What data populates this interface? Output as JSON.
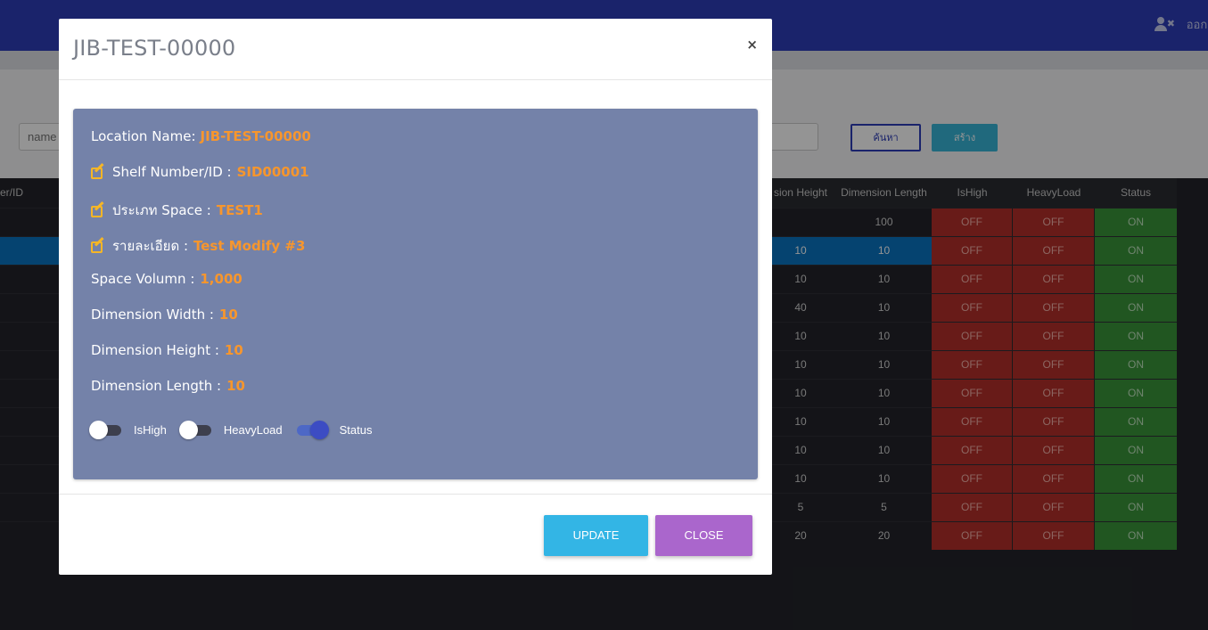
{
  "topbar": {
    "logout_label": "ออกจาก"
  },
  "search": {
    "placeholder": "name",
    "search_label": "ค้นหา",
    "create_label": "สร้าง"
  },
  "table": {
    "left_header_fragment": "er/ID",
    "headers": [
      "sion Height",
      "Dimension Length",
      "IsHigh",
      "HeavyLoad",
      "Status"
    ],
    "rows": [
      {
        "height": "",
        "length": "100",
        "ishigh": "OFF",
        "heavyload": "OFF",
        "status": "ON"
      },
      {
        "height": "10",
        "length": "10",
        "ishigh": "OFF",
        "heavyload": "OFF",
        "status": "ON",
        "selected": true
      },
      {
        "height": "10",
        "length": "10",
        "ishigh": "OFF",
        "heavyload": "OFF",
        "status": "ON"
      },
      {
        "height": "40",
        "length": "10",
        "ishigh": "OFF",
        "heavyload": "OFF",
        "status": "ON"
      },
      {
        "height": "10",
        "length": "10",
        "ishigh": "OFF",
        "heavyload": "OFF",
        "status": "ON"
      },
      {
        "height": "10",
        "length": "10",
        "ishigh": "OFF",
        "heavyload": "OFF",
        "status": "ON"
      },
      {
        "height": "10",
        "length": "10",
        "ishigh": "OFF",
        "heavyload": "OFF",
        "status": "ON"
      },
      {
        "height": "10",
        "length": "10",
        "ishigh": "OFF",
        "heavyload": "OFF",
        "status": "ON"
      },
      {
        "height": "10",
        "length": "10",
        "ishigh": "OFF",
        "heavyload": "OFF",
        "status": "ON"
      },
      {
        "height": "10",
        "length": "10",
        "ishigh": "OFF",
        "heavyload": "OFF",
        "status": "ON"
      },
      {
        "height": "5",
        "length": "5",
        "ishigh": "OFF",
        "heavyload": "OFF",
        "status": "ON"
      },
      {
        "height": "20",
        "length": "20",
        "ishigh": "OFF",
        "heavyload": "OFF",
        "status": "ON"
      }
    ]
  },
  "modal": {
    "title": "JIB-TEST-00000",
    "close_glyph": "×",
    "fields": {
      "location_name": {
        "label": "Location Name:",
        "value": "JIB-TEST-00000"
      },
      "shelf": {
        "label": "Shelf Number/ID :",
        "value": "SID00001"
      },
      "space_type": {
        "label": "ประเภท Space :",
        "value": "TEST1"
      },
      "detail": {
        "label": "รายละเอียด :",
        "value": "Test Modify #3"
      },
      "volume": {
        "label": "Space Volumn :",
        "value": "1,000"
      },
      "width": {
        "label": "Dimension Width :",
        "value": "10"
      },
      "height": {
        "label": "Dimension Height :",
        "value": "10"
      },
      "length": {
        "label": "Dimension Length :",
        "value": "10"
      }
    },
    "toggles": {
      "ishigh": {
        "label": "IsHigh",
        "on": false
      },
      "heavyload": {
        "label": "HeavyLoad",
        "on": false
      },
      "status": {
        "label": "Status",
        "on": true
      }
    },
    "update_label": "UPDATE",
    "close_label": "CLOSE"
  },
  "colors": {
    "topbar": "#2d3db8",
    "card": "#7482a9",
    "value_accent": "#f7962d",
    "update_button": "#33b5e5",
    "close_button": "#aa66cc",
    "off_cell": "#b3302a",
    "on_cell": "#39943a",
    "selected_row": "#0a74c2"
  }
}
